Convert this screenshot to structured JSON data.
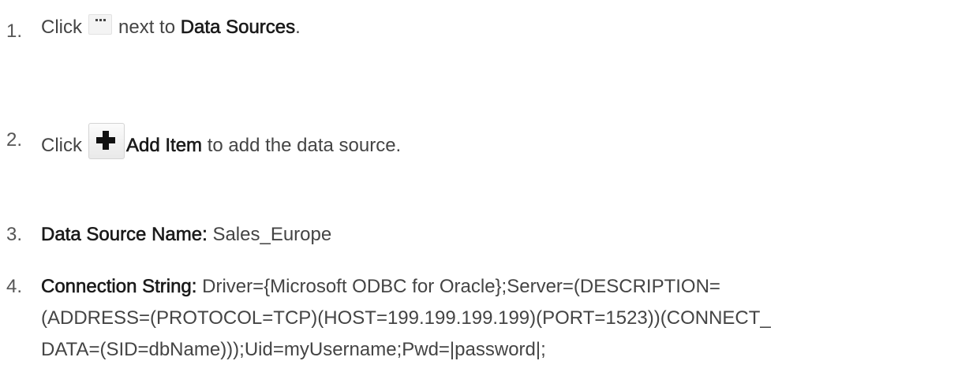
{
  "steps": [
    {
      "number": "1.",
      "click": "Click",
      "icon": "more-options-icon",
      "middle": "next to",
      "target": "Data Sources",
      "end": "."
    },
    {
      "number": "2.",
      "click": "Click",
      "icon": "add-plus-icon",
      "target": "Add Item",
      "end": "to add the data source."
    },
    {
      "number": "3.",
      "label": "Data Source Name:",
      "value": "Sales_Europe"
    },
    {
      "number": "4.",
      "label": "Connection String:",
      "value_lines": [
        "Driver={Microsoft ODBC for Oracle};Server=(DESCRIPTION=",
        "(ADDRESS=(PROTOCOL=TCP)(HOST=199.199.199.199)(PORT=1523))(CONNECT_",
        "DATA=(SID=dbName)));Uid=myUsername;Pwd=|password|;"
      ]
    }
  ]
}
